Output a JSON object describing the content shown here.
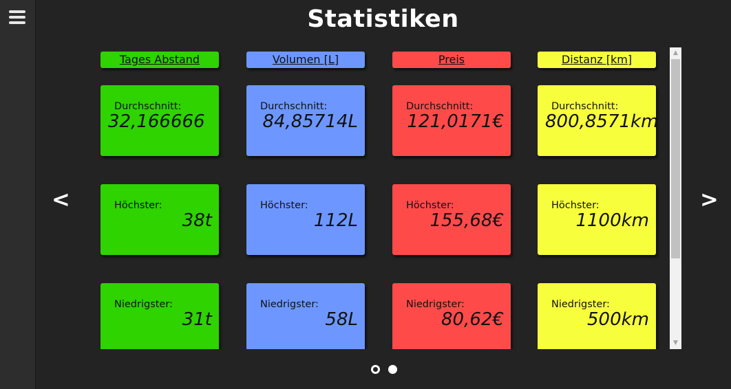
{
  "page": {
    "title": "Statistiken"
  },
  "nav": {
    "prev_label": "<",
    "next_label": ">"
  },
  "colors": {
    "green": "#2ed300",
    "blue": "#6d97ff",
    "red": "#ff4a4a",
    "yellow": "#f7ff3c",
    "background": "#232323"
  },
  "columns": [
    {
      "header": "Tages Abstand",
      "color": "#2ed300",
      "cards": [
        {
          "label": "Durchschnitt:",
          "value": "32,166666"
        },
        {
          "label": "Höchster:",
          "value": "38t"
        },
        {
          "label": "Niedrigster:",
          "value": "31t"
        }
      ]
    },
    {
      "header": "Volumen [L]",
      "color": "#6d97ff",
      "cards": [
        {
          "label": "Durchschnitt:",
          "value": "84,85714L"
        },
        {
          "label": "Höchster:",
          "value": "112L"
        },
        {
          "label": "Niedrigster:",
          "value": "58L"
        }
      ]
    },
    {
      "header": "Preis",
      "color": "#ff4a4a",
      "cards": [
        {
          "label": "Durchschnitt:",
          "value": "121,0171€"
        },
        {
          "label": "Höchster:",
          "value": "155,68€"
        },
        {
          "label": "Niedrigster:",
          "value": "80,62€"
        }
      ]
    },
    {
      "header": "Distanz [km]",
      "color": "#f7ff3c",
      "cards": [
        {
          "label": "Durchschnitt:",
          "value": "800,8571km"
        },
        {
          "label": "Höchster:",
          "value": "1100km"
        },
        {
          "label": "Niedrigster:",
          "value": "500km"
        }
      ]
    }
  ],
  "pagination": {
    "current_page": 1,
    "total_pages": 2
  },
  "icons": {
    "menu": "hamburger-icon",
    "scroll_up": "chevron-up-icon",
    "scroll_down": "chevron-down-icon"
  }
}
